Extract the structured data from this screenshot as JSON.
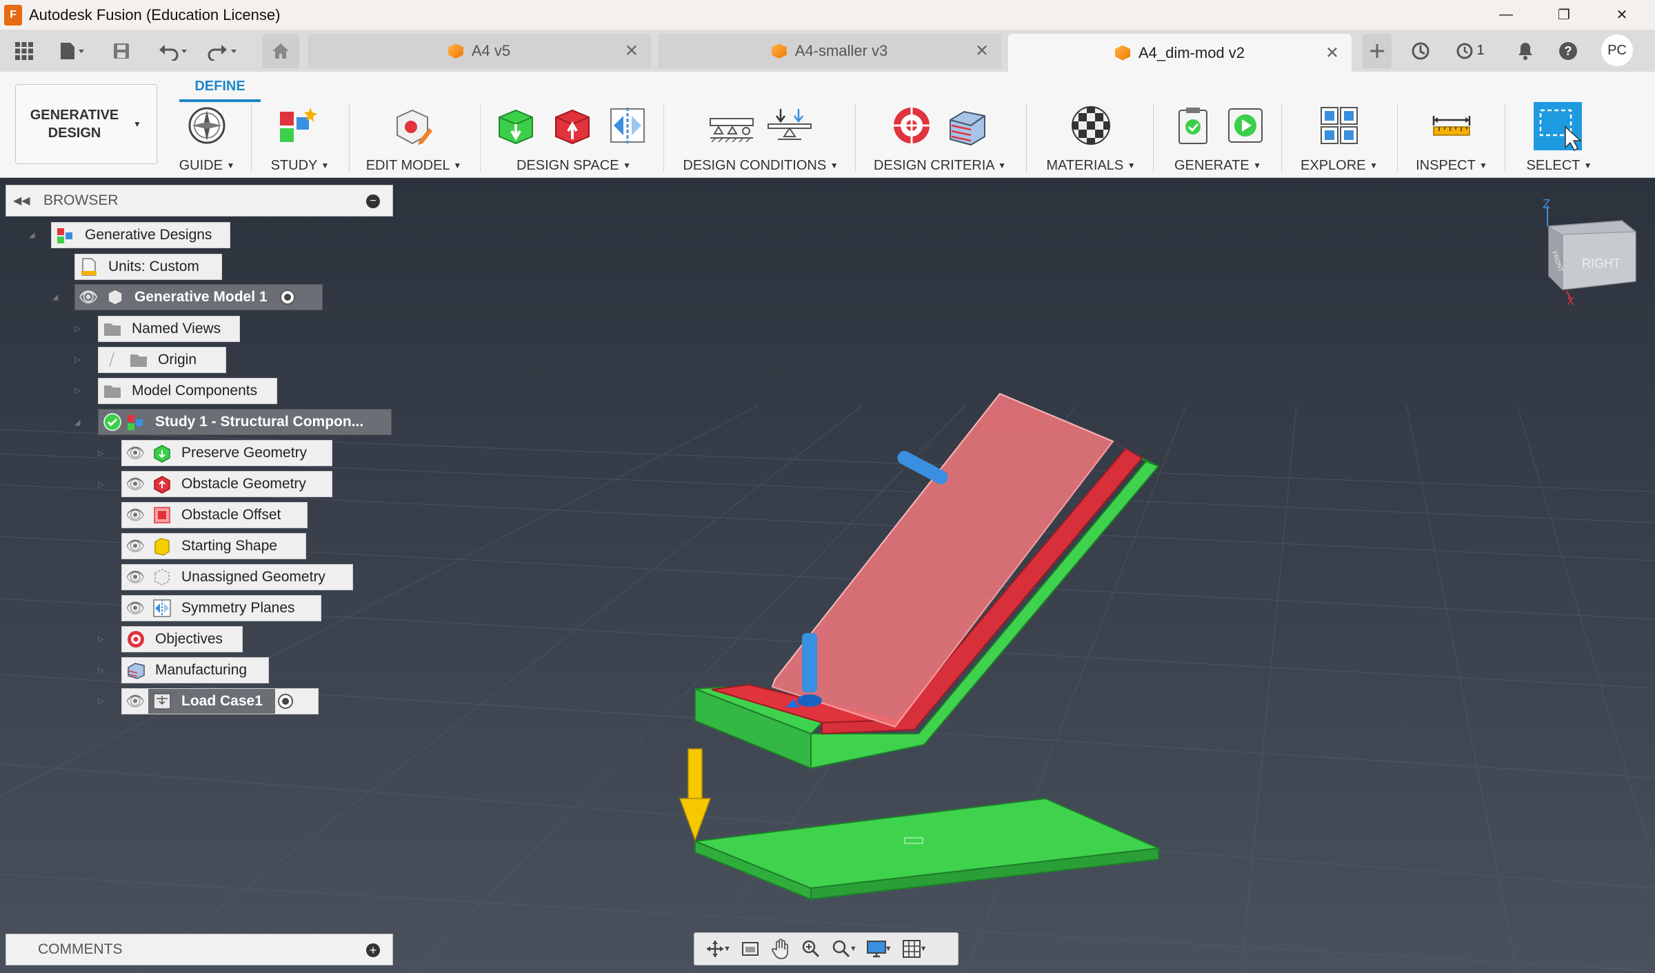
{
  "window": {
    "title": "Autodesk Fusion (Education License)",
    "logo_letter": "F"
  },
  "tabs": [
    {
      "label": "A4 v5",
      "active": false
    },
    {
      "label": "A4-smaller v3",
      "active": false
    },
    {
      "label": "A4_dim-mod v2",
      "active": true
    }
  ],
  "tabbar": {
    "job_count": "1",
    "user_initials": "PC"
  },
  "ribbon": {
    "workspace": "GENERATIVE DESIGN",
    "active_tab": "DEFINE",
    "groups": {
      "guide": "GUIDE",
      "study": "STUDY",
      "edit_model": "EDIT MODEL",
      "design_space": "DESIGN SPACE",
      "design_conditions": "DESIGN CONDITIONS",
      "design_criteria": "DESIGN CRITERIA",
      "materials": "MATERIALS",
      "generate": "GENERATE",
      "explore": "EXPLORE",
      "inspect": "INSPECT",
      "select": "SELECT"
    }
  },
  "browser": {
    "title": "BROWSER",
    "nodes": {
      "generative_designs": "Generative Designs",
      "units": "Units: Custom",
      "model": "Generative Model 1",
      "named_views": "Named Views",
      "origin": "Origin",
      "model_components": "Model Components",
      "study": "Study 1 - Structural Compon...",
      "preserve": "Preserve Geometry",
      "obstacle": "Obstacle Geometry",
      "obstacle_offset": "Obstacle Offset",
      "starting_shape": "Starting Shape",
      "unassigned": "Unassigned Geometry",
      "symmetry": "Symmetry Planes",
      "objectives": "Objectives",
      "manufacturing": "Manufacturing",
      "load_case": "Load Case1"
    }
  },
  "comments": {
    "title": "COMMENTS"
  },
  "viewcube": {
    "face_right": "RIGHT",
    "face_front": "FRONT",
    "axis_z": "Z",
    "axis_x": "X"
  },
  "colors": {
    "preserve_green": "#3ccf4a",
    "obstacle_red": "#e0333c",
    "obstacle_offset_pink": "#f07a7c",
    "load_blue": "#3a8fe0",
    "gravity_yellow": "#f5c800",
    "accent_blue": "#1d87c9"
  }
}
